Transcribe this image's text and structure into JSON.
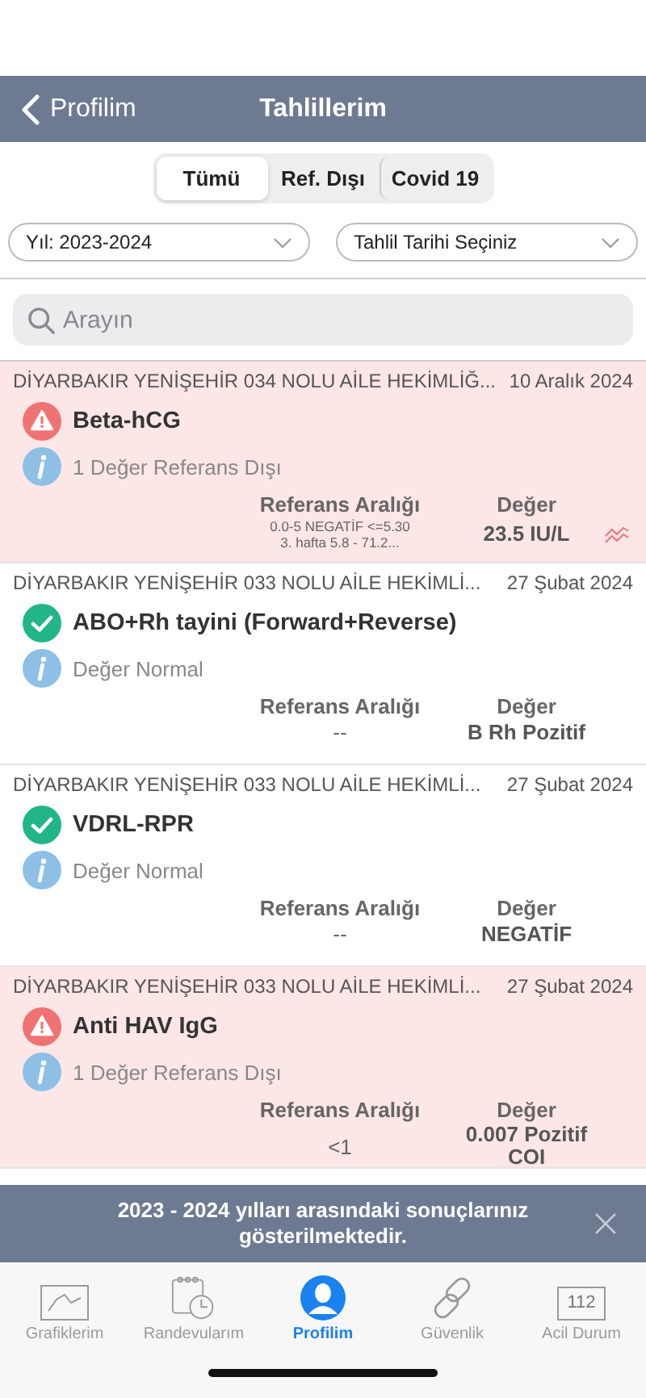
{
  "nav": {
    "back": "Profilim",
    "title": "Tahlillerim"
  },
  "segments": [
    {
      "label": "Tümü",
      "selected": true
    },
    {
      "label": "Ref. Dışı",
      "selected": false
    },
    {
      "label": "Covid 19",
      "selected": false
    }
  ],
  "filters": [
    {
      "value": "Yıl: 2023-2024"
    },
    {
      "value": "Tahlil Tarihi Seçiniz"
    }
  ],
  "search": {
    "placeholder": "Arayın"
  },
  "results": [
    {
      "source": "DİYARBAKIR YENİŞEHİR 034 NOLU AİLE HEKİMLİĞ...",
      "date": "10 Aralık 2024",
      "kind": "alert",
      "name": "Beta-hCG",
      "note": "1 Değer Referans Dışı",
      "ref_label": "Referans Aralığı",
      "value_label": "Değer",
      "ref": "0.0-5 NEGATİF <=5.30\n3. hafta  5.8 - 71.2...",
      "ref_small": true,
      "value": "23.5 IU/L",
      "trend": true
    },
    {
      "source": "DİYARBAKIR YENİŞEHİR 033 NOLU AİLE HEKİMLİ...",
      "date": "27 Şubat 2024",
      "kind": "normal",
      "name": "ABO+Rh tayini (Forward+Reverse)",
      "note": "Değer Normal",
      "ref_label": "Referans Aralığı",
      "value_label": "Değer",
      "ref": "--",
      "ref_small": false,
      "value": "B Rh Pozitif",
      "trend": false
    },
    {
      "source": "DİYARBAKIR YENİŞEHİR 033 NOLU AİLE HEKİMLİ...",
      "date": "27 Şubat 2024",
      "kind": "normal",
      "name": "VDRL-RPR",
      "note": "Değer Normal",
      "ref_label": "Referans Aralığı",
      "value_label": "Değer",
      "ref": "--",
      "ref_small": false,
      "value": "NEGATİF",
      "trend": false
    },
    {
      "source": "DİYARBAKIR YENİŞEHİR 033 NOLU AİLE HEKİMLİ...",
      "date": "27 Şubat 2024",
      "kind": "alert",
      "name": "Anti HAV IgG",
      "note": "1 Değer Referans Dışı",
      "ref_label": "Referans Aralığı",
      "value_label": "Değer",
      "ref": "<1",
      "ref_small": false,
      "value": "0.007 Pozitif\nCOI",
      "trend": false
    }
  ],
  "banner": {
    "text": "2023 - 2024 yılları arasındaki sonuçlarınız gösterilmektedir."
  },
  "tabbar": [
    {
      "label": "Grafiklerim",
      "selected": false
    },
    {
      "label": "Randevularım",
      "selected": false
    },
    {
      "label": "Profilim",
      "selected": true
    },
    {
      "label": "Güvenlik",
      "selected": false
    },
    {
      "label": "Acil Durum",
      "badge": "112",
      "selected": false
    }
  ]
}
